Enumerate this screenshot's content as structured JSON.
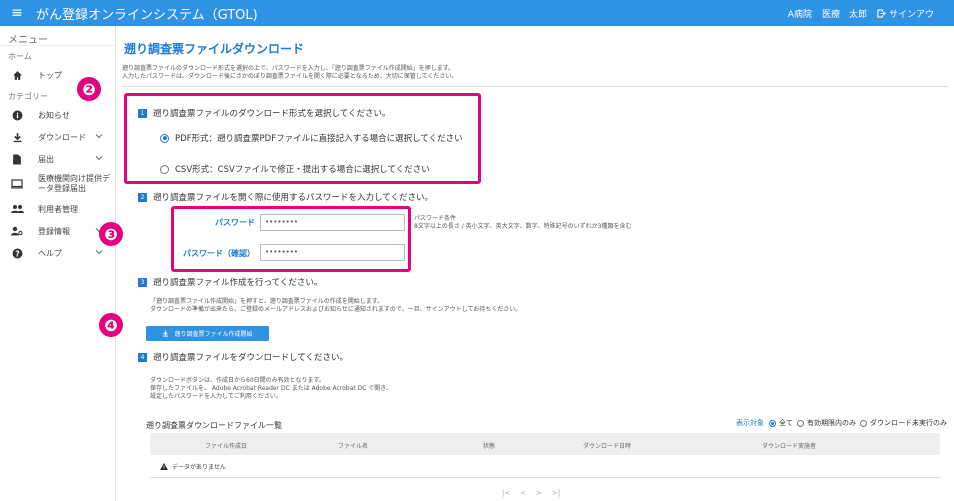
{
  "app": {
    "title": "がん登録オンラインシステム（GTOL)",
    "hospital": "A病院",
    "user": "医療　太郎",
    "signout": "サインアウ"
  },
  "sidebar": {
    "header": "メニュー",
    "home_section": "ホーム",
    "top": "トップ",
    "category_section": "カテゴリー",
    "items": [
      {
        "label": "お知らせ",
        "icon": "info-icon"
      },
      {
        "label": "ダウンロード",
        "icon": "download-icon"
      },
      {
        "label": "届出",
        "icon": "file-icon"
      },
      {
        "label": "医療機関向け提供デ\nータ登録届出",
        "icon": "monitor-icon"
      },
      {
        "label": "利用者管理",
        "icon": "users-icon"
      },
      {
        "label": "登録情報",
        "icon": "user-settings-icon"
      },
      {
        "label": "ヘルプ",
        "icon": "help-icon"
      }
    ]
  },
  "annotations": {
    "badge2": "❷",
    "badge3": "❸",
    "badge4": "❹",
    "color": "#e5007f"
  },
  "page": {
    "title": "遡り調査票ファイルダウンロード",
    "desc1": "遡り調査票ファイルのダウンロード形式を選択の上で、パスワードを入力し、「遡り調査票ファイル作成開始」を押します。",
    "desc2": "入力したパスワードは、ダウンロード後にさかのぼり調査票ファイルを開く際に必要となるため、大切に保管してください。"
  },
  "step1": {
    "num": "1",
    "title": "遡り調査票ファイルのダウンロード形式を選択してください。",
    "options": [
      {
        "label": "PDF形式：遡り調査票PDFファイルに直接記入する場合に選択してください",
        "selected": true
      },
      {
        "label": "CSV形式：CSVファイルで修正・提出する場合に選択してください",
        "selected": false
      }
    ]
  },
  "step2": {
    "num": "2",
    "title": "遡り調査票ファイルを開く際に使用するパスワードを入力してください。",
    "password_label": "パスワード",
    "password_value": "••••••••",
    "confirm_label": "パスワード（確認）",
    "confirm_value": "••••••••",
    "cond_title": "パスワード条件",
    "cond_text": "8文字以上の長さ / 英小文字、英大文字、数字、特殊記号のいずれか3種類を含む"
  },
  "step3": {
    "num": "3",
    "title": "遡り調査票ファイル作成を行ってください。",
    "desc1": "「遡り調査票ファイル作成開始」を押すと、遡り調査票ファイルの作成を開始します。",
    "desc2": "ダウンロードの準備が出来たら、ご登録のメールアドレスおよびお知らせに通知されますので、一旦、サインアウトしてお待ちください。",
    "button": "遡り調査票ファイル作成開始"
  },
  "step4": {
    "num": "4",
    "title": "遡り調査票ファイルをダウンロードしてください。",
    "desc1": "ダウンロードボタンは、作成日から60日間のみ有効となります。",
    "desc2": "保存したファイルを、 Adobe Acrobat Reader DC または Adobe Acrobat DC で開き、",
    "desc3": "設定したパスワードを入力してご利用ください。"
  },
  "list": {
    "title": "遡り調査票ダウンロードファイル一覧",
    "filter_label": "表示対象",
    "filter_options": [
      {
        "label": "全て",
        "selected": true
      },
      {
        "label": "有効期限内のみ",
        "selected": false
      },
      {
        "label": "ダウンロード未実行のみ",
        "selected": false
      }
    ],
    "columns": [
      "ファイル作成日",
      "ファイル名",
      "状態",
      "ダウンロード日時",
      "ダウンロード実施者"
    ],
    "empty": "データがありません",
    "pager": [
      "|<",
      "<",
      ">",
      ">|"
    ]
  }
}
